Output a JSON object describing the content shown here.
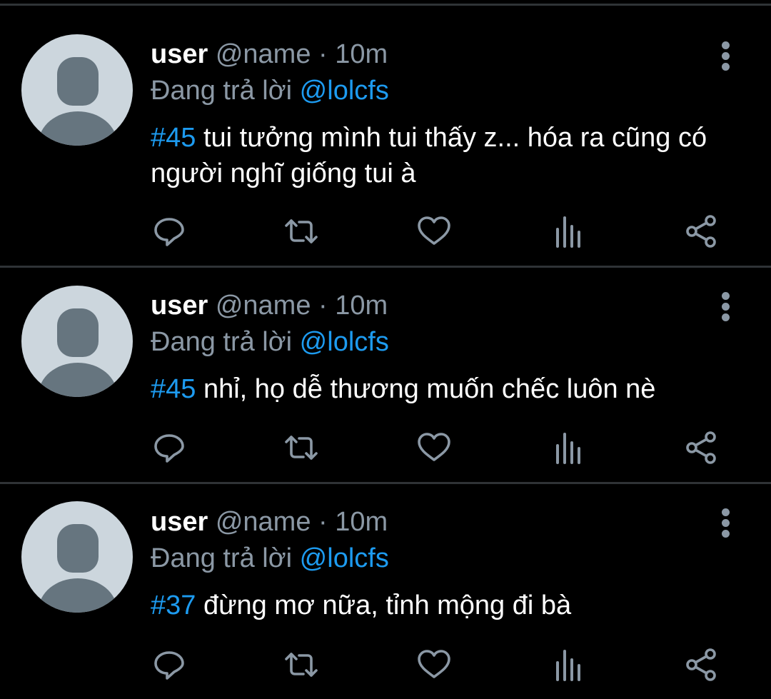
{
  "tweets": [
    {
      "username": "user",
      "handle": "@name",
      "separator": "·",
      "time": "10m",
      "reply_prefix": "Đang trả lời",
      "reply_to": "@lolcfs",
      "hashtag": "#45",
      "text": " tui tưởng mình tui thấy z... hóa ra cũng có người nghĩ giống tui à"
    },
    {
      "username": "user",
      "handle": "@name",
      "separator": "·",
      "time": "10m",
      "reply_prefix": "Đang trả lời",
      "reply_to": "@lolcfs",
      "hashtag": "#45",
      "text": " nhỉ, họ dễ thương muốn chếc luôn nè"
    },
    {
      "username": "user",
      "handle": "@name",
      "separator": "·",
      "time": "10m",
      "reply_prefix": "Đang trả lời",
      "reply_to": "@lolcfs",
      "hashtag": "#37",
      "text": " đừng mơ nữa, tỉnh mộng đi bà"
    }
  ],
  "icons": {
    "avatar": "default-avatar-icon",
    "more": "more-vertical-icon",
    "reply": "reply-icon",
    "retweet": "retweet-icon",
    "like": "like-heart-icon",
    "analytics": "analytics-icon",
    "share": "share-icon"
  },
  "colors": {
    "background": "#000000",
    "text": "#ffffff",
    "muted": "#8b98a5",
    "accent": "#1d9bf0",
    "divider": "#2f3336",
    "avatar_bg": "#ccd6dd",
    "avatar_fg": "#66757f"
  }
}
